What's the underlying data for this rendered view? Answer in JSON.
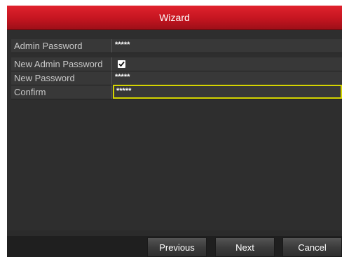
{
  "window": {
    "title": "Wizard"
  },
  "form": {
    "rows": [
      {
        "label": "Admin Password",
        "value": "*****"
      },
      {
        "label": "New Admin Password",
        "checked": true
      },
      {
        "label": "New Password",
        "value": "*****"
      },
      {
        "label": "Confirm",
        "value": "*****"
      }
    ]
  },
  "footer": {
    "previous_label": "Previous",
    "next_label": "Next",
    "cancel_label": "Cancel"
  },
  "colors": {
    "title_bar": "#c41520",
    "focus_border": "#d4d400",
    "background": "#2b2b2b"
  }
}
